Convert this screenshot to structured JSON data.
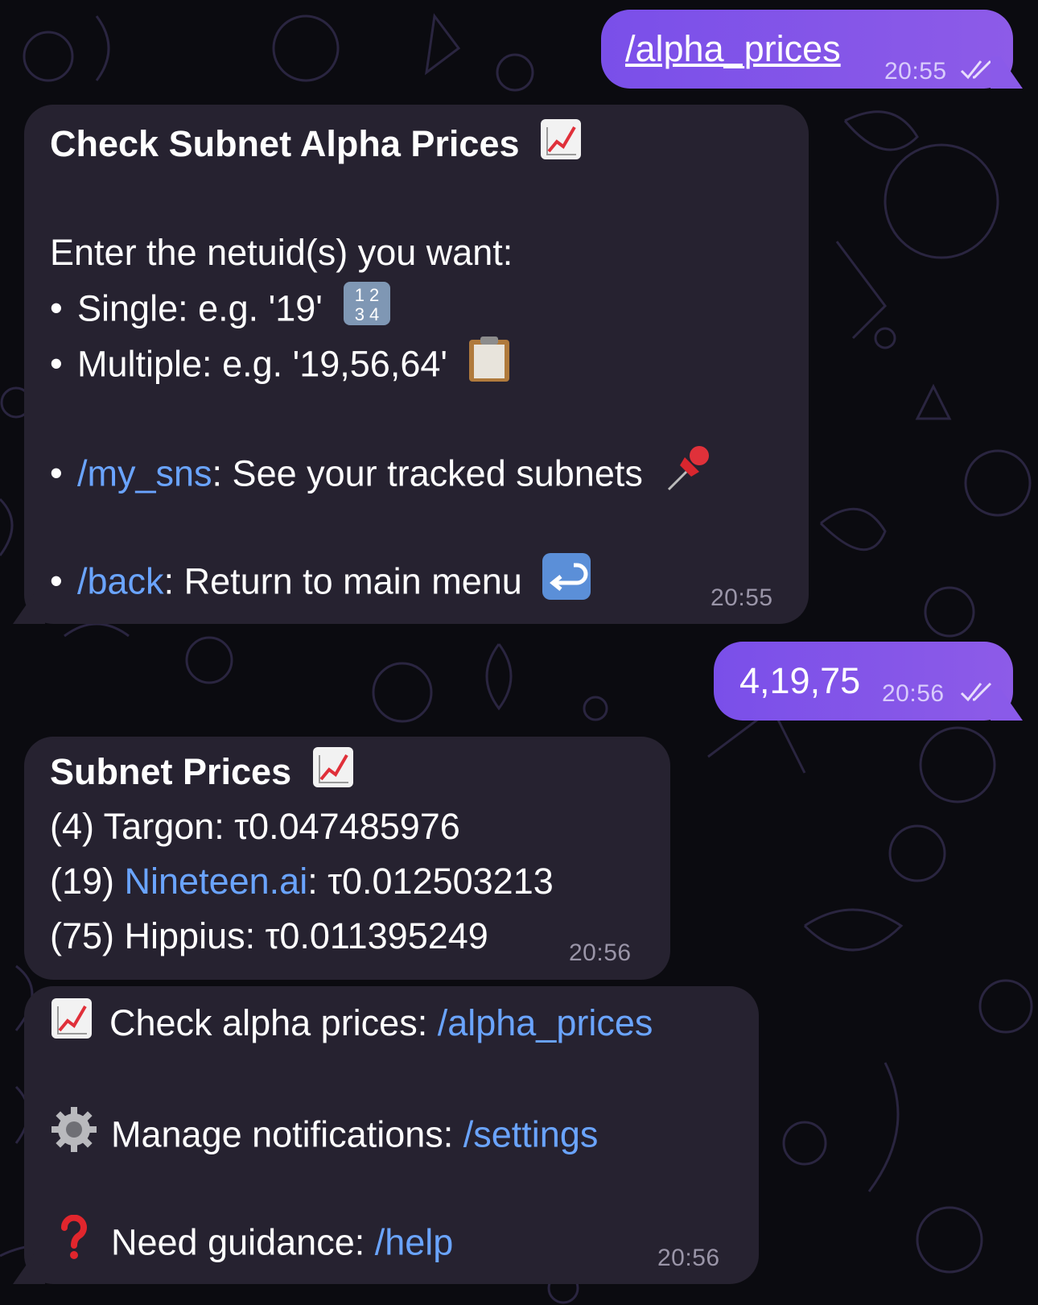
{
  "messages": {
    "m1": {
      "text": "/alpha_prices",
      "time": "20:55"
    },
    "m2": {
      "title": "Check Subnet Alpha Prices",
      "prompt": "Enter the netuid(s) you want:",
      "single": "Single: e.g. '19'",
      "multiple": "Multiple: e.g. '19,56,64'",
      "my_sns_cmd": "/my_sns",
      "my_sns_text": ": See your tracked subnets",
      "back_cmd": "/back",
      "back_text": ": Return to main menu",
      "bullet": "•",
      "time": "20:55"
    },
    "m3": {
      "text": "4,19,75",
      "time": "20:56"
    },
    "m4": {
      "title": "Subnet Prices",
      "row1": "(4) Targon: τ0.047485976",
      "row2_prefix": "(19) ",
      "row2_link": "Nineteen.ai",
      "row2_suffix": ": τ0.012503213",
      "row3": "(75) Hippius: τ0.011395249",
      "time": "20:56"
    },
    "m5": {
      "line1_text": "Check alpha prices: ",
      "line1_cmd": "/alpha_prices",
      "line2_text": "Manage notifications: ",
      "line2_cmd": "/settings",
      "line3_text": "Need guidance: ",
      "line3_cmd": "/help",
      "time": "20:56"
    }
  },
  "icons": {
    "chart": "chart-increasing-icon",
    "numbers": "input-numbers-icon",
    "clipboard": "clipboard-icon",
    "pin": "pushpin-icon",
    "return": "return-arrow-icon",
    "gear": "gear-icon",
    "question": "question-mark-icon",
    "read": "double-check-icon"
  },
  "colors": {
    "outgoing": "#8a5ae9",
    "incoming": "#262230",
    "link": "#6aa4ff",
    "background": "#0b0b10"
  }
}
